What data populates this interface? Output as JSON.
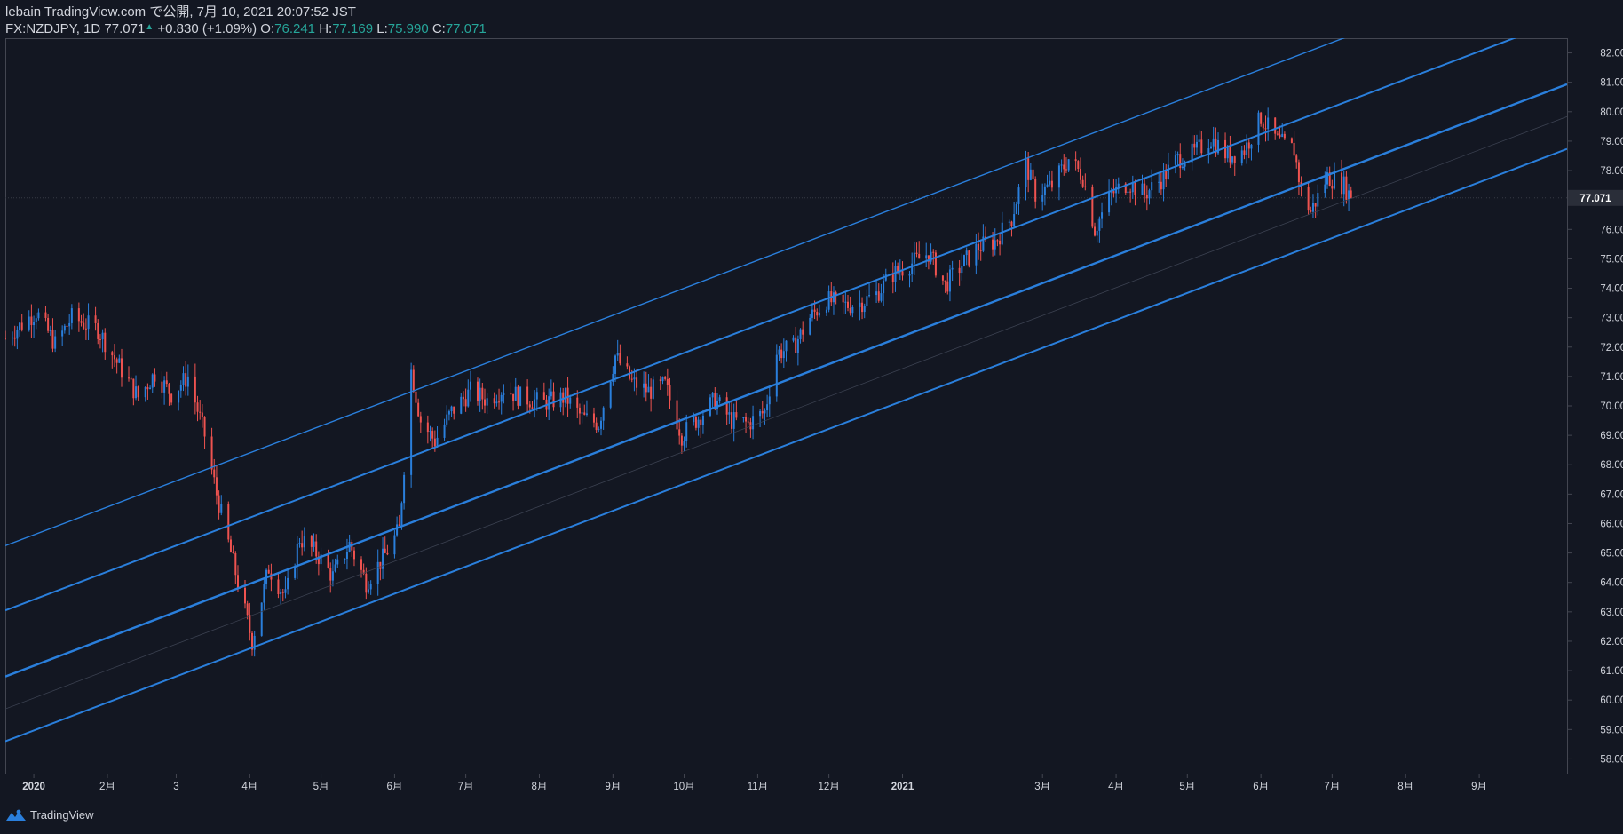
{
  "header": {
    "line1": "lebain TradingView.com で公開, 7月 10, 2021 20:07:52 JST",
    "symbol": "FX:NZDJPY, 1D 77.071",
    "arrow": "▲",
    "change": "+0.830 (+1.09%)",
    "o_label": "O:",
    "o_value": "76.241",
    "h_label": "H:",
    "h_value": "77.169",
    "l_label": "L:",
    "l_value": "75.990",
    "c_label": "C:",
    "c_value": "77.071"
  },
  "footer": {
    "brand": "TradingView",
    "logo_icon": "tradingview-logo-icon"
  },
  "colors": {
    "background": "#131722",
    "up": "#2a7fdc",
    "down": "#ef5350",
    "channel": "#2a7fdc",
    "axis_text": "#d1d4dc"
  },
  "chart_data": {
    "type": "candlestick",
    "symbol": "FX:NZDJPY",
    "interval": "1D",
    "last_price": 77.071,
    "last_price_label": "77.071",
    "ylim": [
      57.5,
      82.5
    ],
    "y_ticks": [
      58,
      59,
      60,
      61,
      62,
      63,
      64,
      65,
      66,
      67,
      68,
      69,
      70,
      71,
      72,
      73,
      74,
      75,
      76,
      77,
      78,
      79,
      80,
      81,
      82
    ],
    "y_tick_labels": [
      "58.000",
      "59.000",
      "60.000",
      "61.000",
      "62.000",
      "63.000",
      "64.000",
      "65.000",
      "66.000",
      "67.000",
      "68.000",
      "69.000",
      "70.000",
      "71.000",
      "72.000",
      "73.000",
      "74.000",
      "75.000",
      "76.000",
      "77.000",
      "78.000",
      "79.000",
      "80.000",
      "81.000",
      "82.000"
    ],
    "x_range": [
      "2019-12-20",
      "2021-10-08"
    ],
    "x_ticks": [
      {
        "date": "2020-01-01",
        "label": "2020"
      },
      {
        "date": "2020-02-01",
        "label": "2月"
      },
      {
        "date": "2020-03-01",
        "label": "3"
      },
      {
        "date": "2020-04-01",
        "label": "4月"
      },
      {
        "date": "2020-05-01",
        "label": "5月"
      },
      {
        "date": "2020-06-01",
        "label": "6月"
      },
      {
        "date": "2020-07-01",
        "label": "7月"
      },
      {
        "date": "2020-08-01",
        "label": "8月"
      },
      {
        "date": "2020-09-01",
        "label": "9月"
      },
      {
        "date": "2020-10-01",
        "label": "10月"
      },
      {
        "date": "2020-11-01",
        "label": "11月"
      },
      {
        "date": "2020-12-01",
        "label": "12月"
      },
      {
        "date": "2021-01-01",
        "label": "2021"
      },
      {
        "date": "2021-03-01",
        "label": "3月"
      },
      {
        "date": "2021-04-01",
        "label": "4月"
      },
      {
        "date": "2021-05-01",
        "label": "5月"
      },
      {
        "date": "2021-06-01",
        "label": "6月"
      },
      {
        "date": "2021-07-01",
        "label": "7月"
      },
      {
        "date": "2021-08-01",
        "label": "8月"
      },
      {
        "date": "2021-09-01",
        "label": "9月"
      }
    ],
    "anchors": [
      [
        "2019-12-20",
        72.3
      ],
      [
        "2020-01-02",
        73.2
      ],
      [
        "2020-01-10",
        72.1
      ],
      [
        "2020-01-17",
        73.0
      ],
      [
        "2020-01-28",
        72.6
      ],
      [
        "2020-02-07",
        71.2
      ],
      [
        "2020-02-14",
        70.3
      ],
      [
        "2020-02-21",
        71.1
      ],
      [
        "2020-02-28",
        70.4
      ],
      [
        "2020-03-06",
        71.0
      ],
      [
        "2020-03-13",
        69.0
      ],
      [
        "2020-03-18",
        67.0
      ],
      [
        "2020-03-24",
        65.0
      ],
      [
        "2020-03-30",
        63.0
      ],
      [
        "2020-04-02",
        62.0
      ],
      [
        "2020-04-09",
        64.5
      ],
      [
        "2020-04-16",
        63.5
      ],
      [
        "2020-04-22",
        65.5
      ],
      [
        "2020-04-29",
        65.0
      ],
      [
        "2020-05-06",
        64.2
      ],
      [
        "2020-05-13",
        65.3
      ],
      [
        "2020-05-20",
        64.0
      ],
      [
        "2020-05-27",
        64.8
      ],
      [
        "2020-06-03",
        65.8
      ],
      [
        "2020-06-08",
        71.2
      ],
      [
        "2020-06-12",
        69.5
      ],
      [
        "2020-06-18",
        68.8
      ],
      [
        "2020-06-25",
        69.8
      ],
      [
        "2020-07-03",
        70.5
      ],
      [
        "2020-07-10",
        70.2
      ],
      [
        "2020-07-17",
        70.6
      ],
      [
        "2020-07-24",
        70.3
      ],
      [
        "2020-08-03",
        70.1
      ],
      [
        "2020-08-12",
        70.3
      ],
      [
        "2020-08-19",
        69.6
      ],
      [
        "2020-08-26",
        69.4
      ],
      [
        "2020-09-02",
        71.7
      ],
      [
        "2020-09-09",
        70.8
      ],
      [
        "2020-09-16",
        70.5
      ],
      [
        "2020-09-23",
        70.7
      ],
      [
        "2020-09-30",
        69.0
      ],
      [
        "2020-10-07",
        69.6
      ],
      [
        "2020-10-14",
        70.2
      ],
      [
        "2020-10-21",
        69.5
      ],
      [
        "2020-10-28",
        69.4
      ],
      [
        "2020-11-04",
        69.8
      ],
      [
        "2020-11-09",
        71.8
      ],
      [
        "2020-11-16",
        72.0
      ],
      [
        "2020-11-23",
        73.0
      ],
      [
        "2020-11-30",
        73.6
      ],
      [
        "2020-12-07",
        73.4
      ],
      [
        "2020-12-14",
        73.5
      ],
      [
        "2020-12-21",
        73.8
      ],
      [
        "2020-12-28",
        74.5
      ],
      [
        "2021-01-06",
        74.9
      ],
      [
        "2021-01-12",
        75.2
      ],
      [
        "2021-01-19",
        74.1
      ],
      [
        "2021-01-26",
        74.8
      ],
      [
        "2021-02-02",
        75.4
      ],
      [
        "2021-02-09",
        75.6
      ],
      [
        "2021-02-16",
        76.4
      ],
      [
        "2021-02-22",
        78.2
      ],
      [
        "2021-02-26",
        77.2
      ],
      [
        "2021-03-05",
        77.5
      ],
      [
        "2021-03-12",
        78.4
      ],
      [
        "2021-03-18",
        77.8
      ],
      [
        "2021-03-23",
        76.0
      ],
      [
        "2021-03-30",
        77.2
      ],
      [
        "2021-04-06",
        77.6
      ],
      [
        "2021-04-13",
        77.2
      ],
      [
        "2021-04-20",
        77.7
      ],
      [
        "2021-04-27",
        78.4
      ],
      [
        "2021-05-04",
        78.6
      ],
      [
        "2021-05-11",
        79.1
      ],
      [
        "2021-05-18",
        78.5
      ],
      [
        "2021-05-25",
        78.7
      ],
      [
        "2021-06-01",
        79.8
      ],
      [
        "2021-06-08",
        79.0
      ],
      [
        "2021-06-15",
        78.7
      ],
      [
        "2021-06-18",
        77.3
      ],
      [
        "2021-06-22",
        76.6
      ],
      [
        "2021-06-29",
        77.8
      ],
      [
        "2021-07-06",
        77.5
      ],
      [
        "2021-07-09",
        77.071
      ]
    ],
    "channel_lines": [
      {
        "name": "outer-upper",
        "points": [
          [
            "2019-12-20",
            65.25
          ],
          [
            "2021-07-09",
            82.6
          ]
        ],
        "width": 1.4
      },
      {
        "name": "upper",
        "points": [
          [
            "2019-12-20",
            63.05
          ],
          [
            "2021-07-09",
            80.4
          ]
        ],
        "width": 2
      },
      {
        "name": "median",
        "points": [
          [
            "2019-12-20",
            60.8
          ],
          [
            "2021-07-09",
            78.15
          ]
        ],
        "width": 2.4
      },
      {
        "name": "lower",
        "points": [
          [
            "2019-12-20",
            58.6
          ],
          [
            "2021-07-09",
            75.95
          ]
        ],
        "width": 2
      }
    ]
  }
}
